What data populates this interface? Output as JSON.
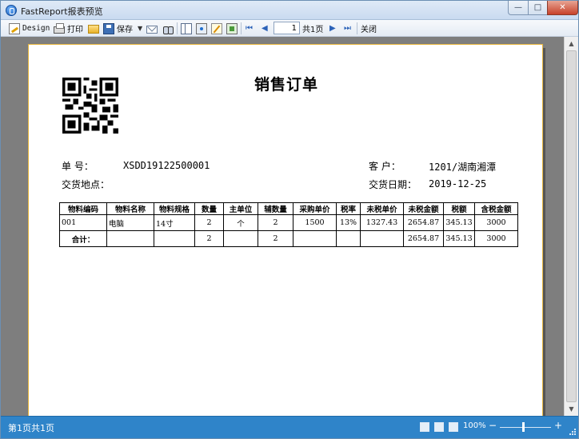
{
  "window": {
    "title": "FastReport报表预览",
    "controls": {
      "minimize": "—",
      "maximize": "□",
      "close": "✕"
    }
  },
  "toolbar": {
    "design_label": "Design",
    "print_label": "打印",
    "save_label": "保存",
    "page_value": "1",
    "total_pages_label": "共1页",
    "close_label": "关闭",
    "nav": {
      "first": "⏮",
      "prev": "◀",
      "next": "▶",
      "last": "⏭"
    }
  },
  "report": {
    "title": "销售订单",
    "order_no_label": "单    号：",
    "order_no": "XSDD19122500001",
    "customer_label": "客    户：",
    "customer": "1201/湖南湘潭",
    "delivery_place_label": "交货地点：",
    "delivery_place": "",
    "delivery_date_label": "交货日期：",
    "delivery_date": "2019-12-25",
    "table": {
      "headers": [
        "物料编码",
        "物料名称",
        "物料规格",
        "数量",
        "主单位",
        "辅数量",
        "采购单价",
        "税率",
        "未税单价",
        "未税金额",
        "税额",
        "含税金额"
      ],
      "rows": [
        [
          "001",
          "电脑",
          "14寸",
          "2",
          "个",
          "2",
          "1500",
          "13%",
          "1327.43",
          "2654.87",
          "345.13",
          "3000"
        ]
      ],
      "total": [
        "合计：",
        "",
        "",
        "2",
        "",
        "2",
        "",
        "",
        "",
        "2654.87",
        "345.13",
        "3000"
      ]
    }
  },
  "statusbar": {
    "page_info": "第1页共1页",
    "zoom": "100%",
    "zoom_minus": "−",
    "zoom_plus": "+"
  },
  "colors": {
    "statusbar": "#2f84c9",
    "paper_border": "#e7b53c",
    "preview_bg": "#7e7e7e"
  },
  "icons": [
    "app-icon",
    "design-icon",
    "print-icon",
    "open-folder-icon",
    "save-icon",
    "email-icon",
    "find-icon",
    "page-setup-icon",
    "settings-icon",
    "edit-icon",
    "outline-icon"
  ]
}
